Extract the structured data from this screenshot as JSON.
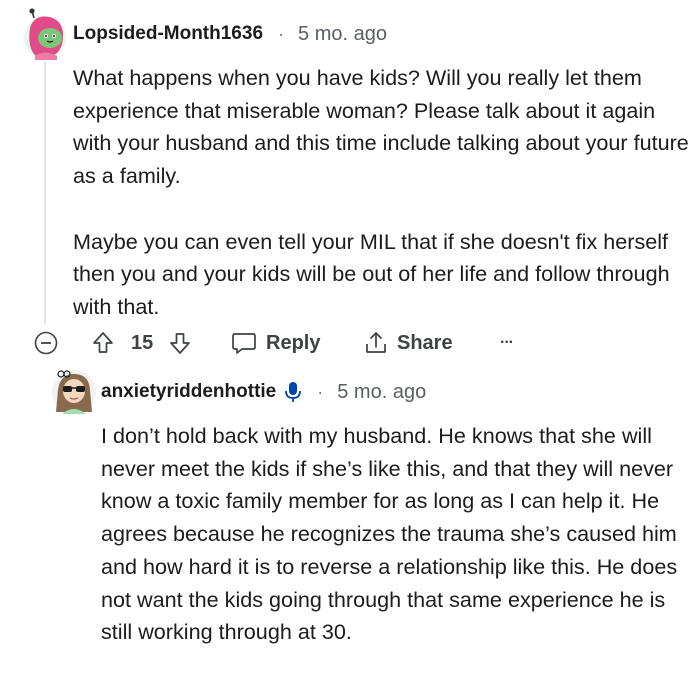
{
  "comments": [
    {
      "username": "Lopsided-Month1636",
      "separator": "·",
      "time": "5 mo. ago",
      "paragraphs": [
        "What happens when you have kids? Will you really let them experience that miserable woman? Please talk about it again with your husband and this time include talking about your future as a family.",
        "Maybe you can even tell your MIL that if she doesn't fix herself then you and your kids will be out of her life and follow through with that."
      ],
      "actions": {
        "vote_count": "15",
        "reply_label": "Reply",
        "share_label": "Share",
        "more_label": "···"
      }
    },
    {
      "username": "anxietyriddenhottie",
      "separator": "·",
      "time": "5 mo. ago",
      "paragraphs": [
        "I don’t hold back with my husband. He knows that she will never meet the kids if she’s like this, and that they will never know a toxic family member for as long as I can help it. He agrees because he recognizes the trauma she’s caused him and how hard it is to reverse a relationship like this. He does not want the kids going through that same experience he is still working through at 30."
      ]
    }
  ],
  "icons": {
    "collapse": "collapse-minus-icon",
    "upvote": "upvote-arrow-icon",
    "downvote": "downvote-arrow-icon",
    "reply": "reply-bubble-icon",
    "share": "share-icon",
    "mic": "microphone-icon"
  },
  "colors": {
    "text": "#1c1c1c",
    "muted": "#5a5f63",
    "thread_line": "#dfe3e6",
    "mic_blue": "#0045ac",
    "avatar1_bg": "#e8f7ea",
    "avatar1_hair": "#e14b8a",
    "avatar2_hair": "#8a6a4e"
  }
}
